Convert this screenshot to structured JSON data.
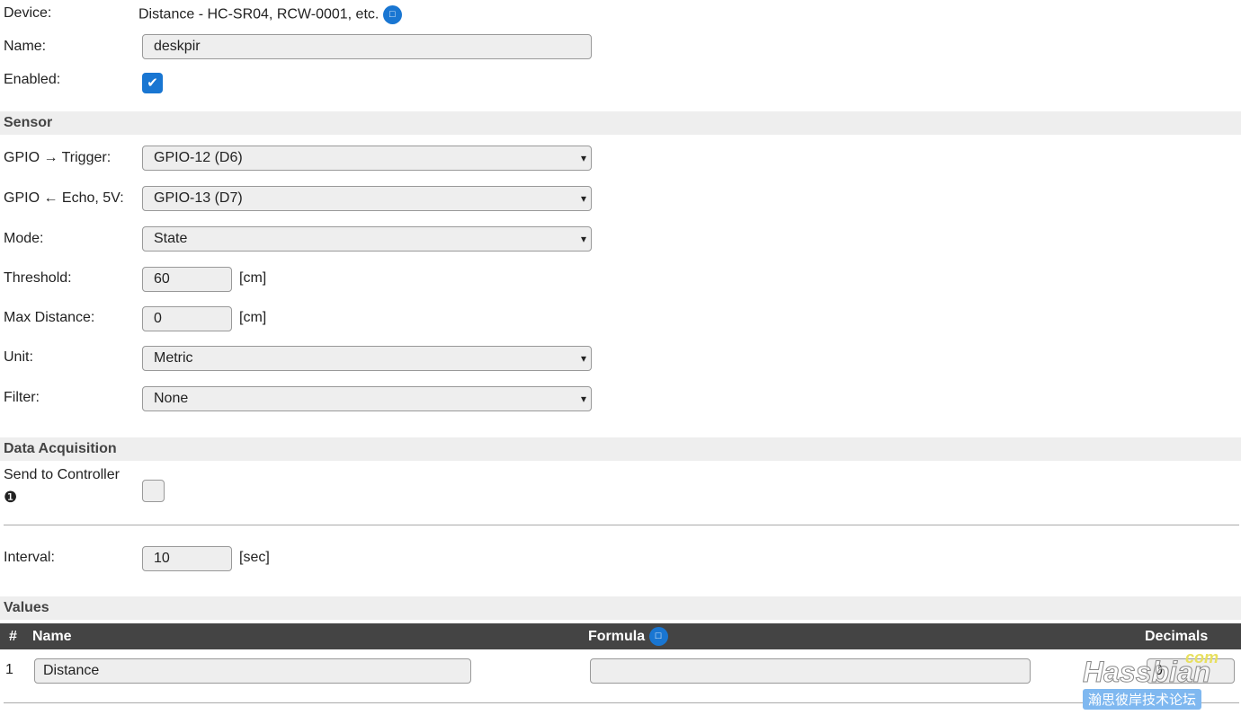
{
  "device": {
    "label": "Device:",
    "value": "Distance - HC-SR04, RCW-0001, etc."
  },
  "name": {
    "label": "Name:",
    "value": "deskpir"
  },
  "enabled": {
    "label": "Enabled:",
    "checked": true
  },
  "sensor": {
    "header": "Sensor",
    "trigger": {
      "label": "GPIO → Trigger:",
      "value": "GPIO-12 (D6)"
    },
    "echo": {
      "label": "GPIO ← Echo, 5V:",
      "value": "GPIO-13 (D7)"
    },
    "mode": {
      "label": "Mode:",
      "value": "State"
    },
    "threshold": {
      "label": "Threshold:",
      "value": "60",
      "unit": "[cm]"
    },
    "max_distance": {
      "label": "Max Distance:",
      "value": "0",
      "unit": "[cm]"
    },
    "unit": {
      "label": "Unit:",
      "value": "Metric"
    },
    "filter": {
      "label": "Filter:",
      "value": "None"
    }
  },
  "acquisition": {
    "header": "Data Acquisition",
    "send_label": "Send to Controller",
    "send_note": "❶",
    "send_checked": false,
    "interval": {
      "label": "Interval:",
      "value": "10",
      "unit": "[sec]"
    }
  },
  "values": {
    "header": "Values",
    "columns": [
      "#",
      "Name",
      "Formula",
      "Decimals"
    ],
    "rows": [
      {
        "index": "1",
        "name": "Distance",
        "formula": "",
        "decimals": "0"
      }
    ]
  },
  "watermark": {
    "text": "Hassbian",
    "suffix": "com",
    "subtitle": "瀚思彼岸技术论坛"
  },
  "colors": {
    "accent": "#1976d2",
    "table_header": "#444444"
  }
}
